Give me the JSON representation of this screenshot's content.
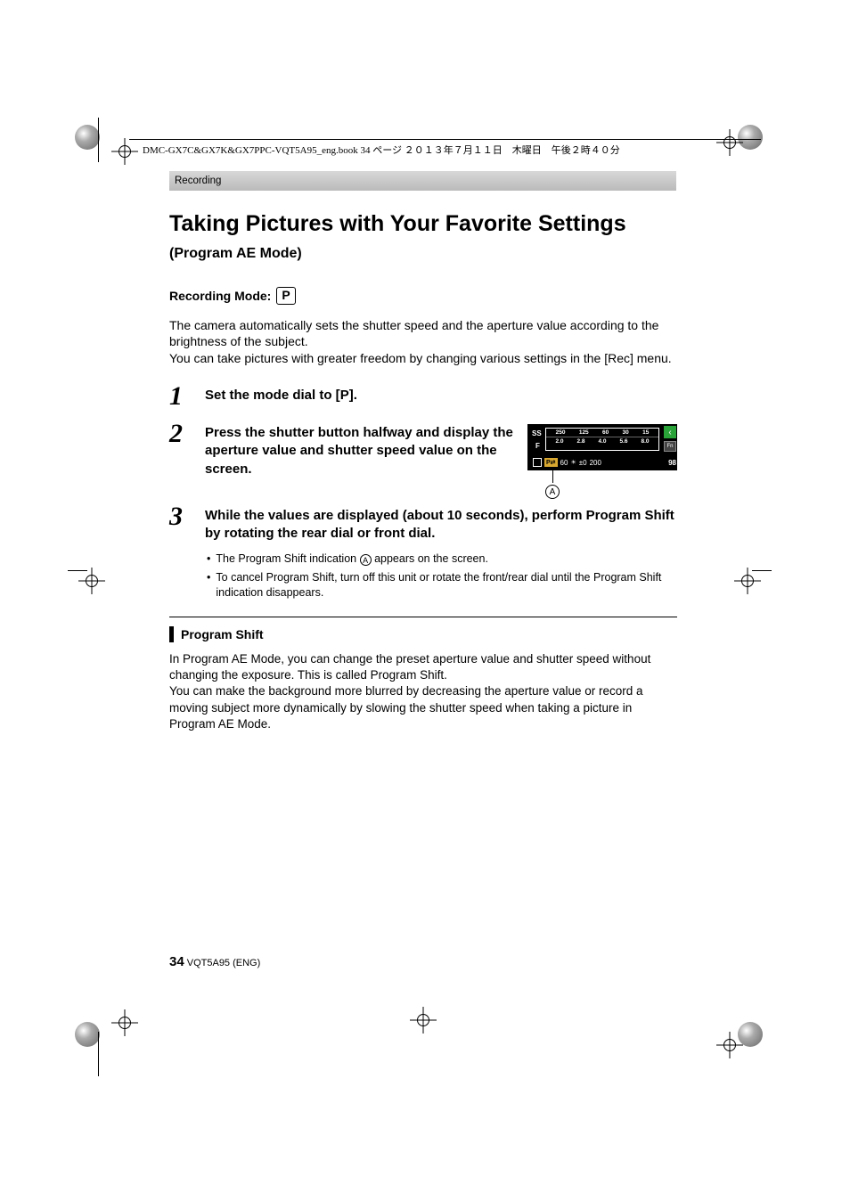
{
  "header_text": "DMC-GX7C&GX7K&GX7PPC-VQT5A95_eng.book  34 ページ  ２０１３年７月１１日　木曜日　午後２時４０分",
  "section_label": "Recording",
  "title": "Taking Pictures with Your Favorite Settings",
  "subtitle": "(Program AE Mode)",
  "recording_mode_label": "Recording Mode:",
  "recording_mode_icon": "P",
  "intro_text": "The camera automatically sets the shutter speed and the aperture value according to the brightness of the subject.\nYou can take pictures with greater freedom by changing various settings in the [Rec] menu.",
  "steps": [
    {
      "num": "1",
      "title_pre": "Set the mode dial to [",
      "title_icon": "P",
      "title_post": "]."
    },
    {
      "num": "2",
      "title": "Press the shutter button halfway and display the aperture value and shutter speed value on the screen."
    },
    {
      "num": "3",
      "title": "While the values are displayed (about 10 seconds), perform Program Shift by rotating the rear dial or front dial.",
      "bullets": [
        {
          "pre": "The Program Shift indication ",
          "a": "A",
          "post": " appears on the screen."
        },
        {
          "text": "To cancel Program Shift, turn off this unit or rotate the front/rear dial until the Program Shift indication disappears."
        }
      ]
    }
  ],
  "display": {
    "ss_label": "SS",
    "f_label": "F",
    "ss_values": [
      "250",
      "125",
      "60",
      "30",
      "15"
    ],
    "f_values": [
      "2.0",
      "2.8",
      "4.0",
      "5.6",
      "8.0"
    ],
    "ps_icon": "P⇄",
    "val_60": "60",
    "ev": "±0",
    "iso": "200",
    "fn": "Fn",
    "right_arrow": "‹",
    "count": "98",
    "callout_letter": "A"
  },
  "program_shift": {
    "heading": "Program Shift",
    "body": "In Program AE Mode, you can change the preset aperture value and shutter speed without changing the exposure. This is called Program Shift.\nYou can make the background more blurred by decreasing the aperture value or record a moving subject more dynamically by slowing the shutter speed when taking a picture in Program AE Mode."
  },
  "footer": {
    "page_num": "34",
    "doc_id": "VQT5A95 (ENG)"
  }
}
